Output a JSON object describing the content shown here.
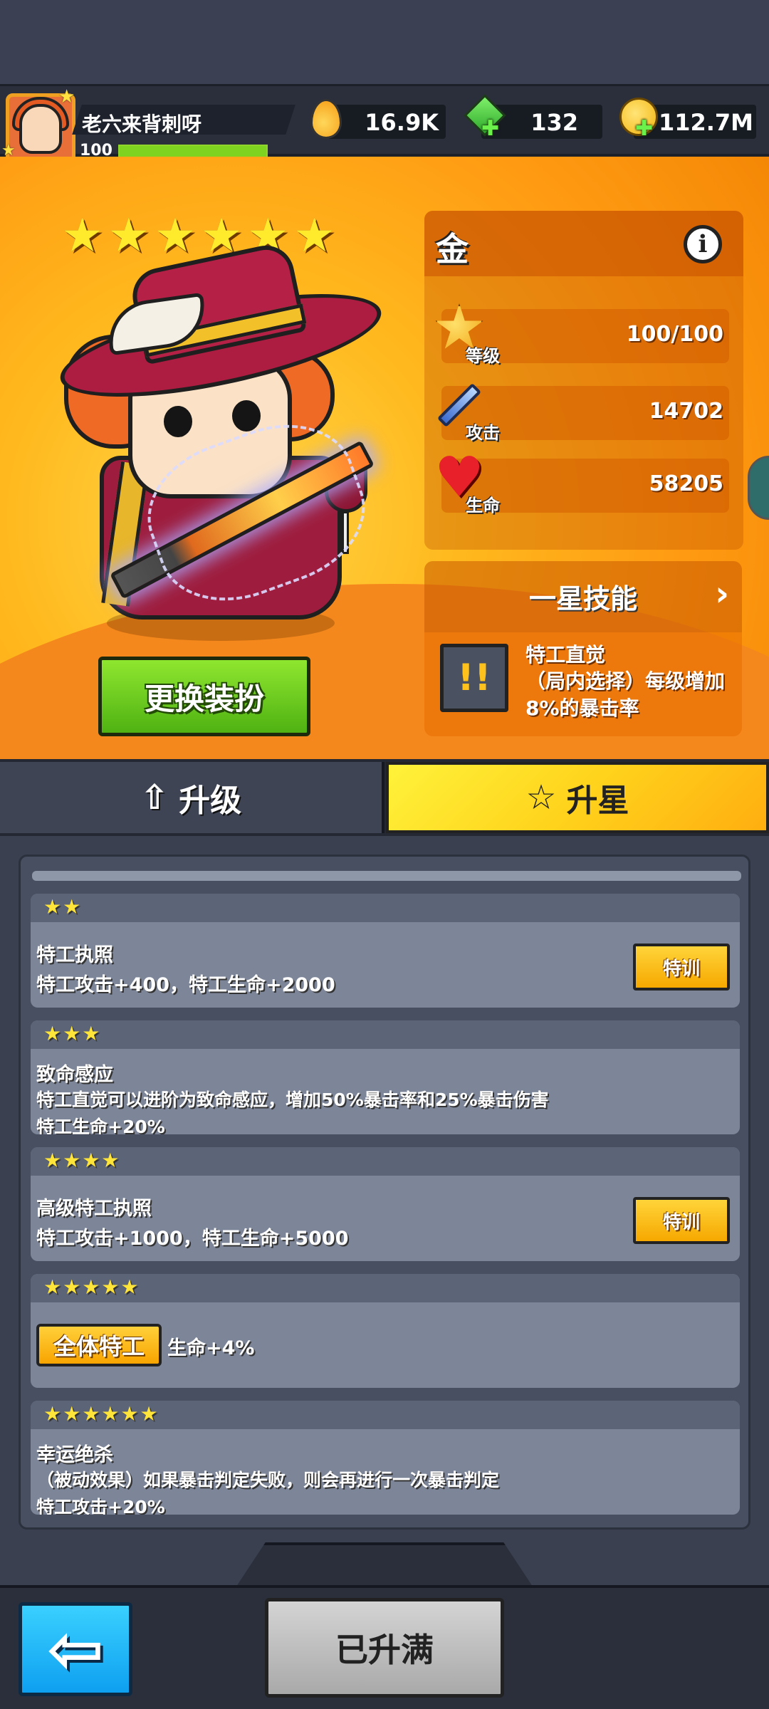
{
  "player": {
    "name": "老六来背刺呀",
    "level": "100",
    "xp_fraction": 1.0
  },
  "resources": {
    "energy": "16.9K",
    "gems": "132",
    "coins": "112.7M"
  },
  "hero": {
    "star_count": 6,
    "stars": "★★★★★★",
    "change_outfit_label": "更换装扮"
  },
  "stats": {
    "rarity": "金",
    "info_icon": "i",
    "level_label": "等级",
    "level_value": "100/100",
    "attack_label": "攻击",
    "attack_value": "14702",
    "hp_label": "生命",
    "hp_value": "58205"
  },
  "skill": {
    "title": "一星技能",
    "name": "特工直觉",
    "desc": "（局内选择）每级增加8%的暴击率"
  },
  "tabs": {
    "upgrade": "升级",
    "star_up": "升星",
    "active": "star_up"
  },
  "star_list": [
    {
      "stars": "★★",
      "line1": "特工执照",
      "line2": "特工攻击+400，特工生命+2000",
      "button": "特训"
    },
    {
      "stars": "★★★",
      "line1": "致命感应",
      "line2": "特工直觉可以进阶为致命感应，增加50%暴击率和25%暴击伤害",
      "line3": "特工生命+20%"
    },
    {
      "stars": "★★★★",
      "line1": "高级特工执照",
      "line2": "特工攻击+1000，特工生命+5000",
      "button": "特训"
    },
    {
      "stars": "★★★★★",
      "badge": "全体特工",
      "line1": "生命+4%"
    },
    {
      "stars": "★★★★★★",
      "line1": "幸运绝杀",
      "line2": "（被动效果）如果暴击判定失败，则会再进行一次暴击判定",
      "line3": "特工攻击+20%"
    }
  ],
  "bottom": {
    "maxed_label": "已升满"
  },
  "colors": {
    "hero_bg": "#ffb91e",
    "train_button": "#f6a800",
    "star_tab": "#ffd31c",
    "back_button": "#0ea0f0"
  }
}
